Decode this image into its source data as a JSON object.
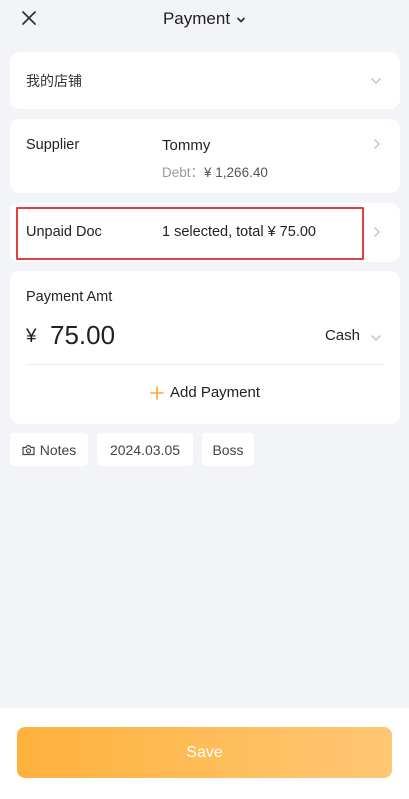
{
  "header": {
    "title": "Payment",
    "close_icon": "close-icon",
    "title_icon": "chevron-down-icon"
  },
  "store": {
    "name": "我的店铺",
    "icon": "chevron-down-icon"
  },
  "supplier": {
    "label": "Supplier",
    "name": "Tommy",
    "debt_label": "Debt：",
    "debt_value": "¥ 1,266.40",
    "icon": "chevron-right-icon"
  },
  "unpaid_doc": {
    "label": "Unpaid Doc",
    "value": "1 selected, total ¥ 75.00",
    "icon": "chevron-right-icon"
  },
  "payment": {
    "label": "Payment Amt",
    "currency": "¥",
    "amount": "75.00",
    "method": "Cash",
    "add_label": "Add Payment",
    "add_icon": "plus-icon"
  },
  "chips": {
    "notes": "Notes",
    "notes_icon": "camera-icon",
    "date": "2024.03.05",
    "user": "Boss"
  },
  "footer": {
    "save_label": "Save"
  },
  "colors": {
    "accent": "#ffb13c",
    "highlight": "#e04040",
    "background": "#f2f4f7"
  }
}
